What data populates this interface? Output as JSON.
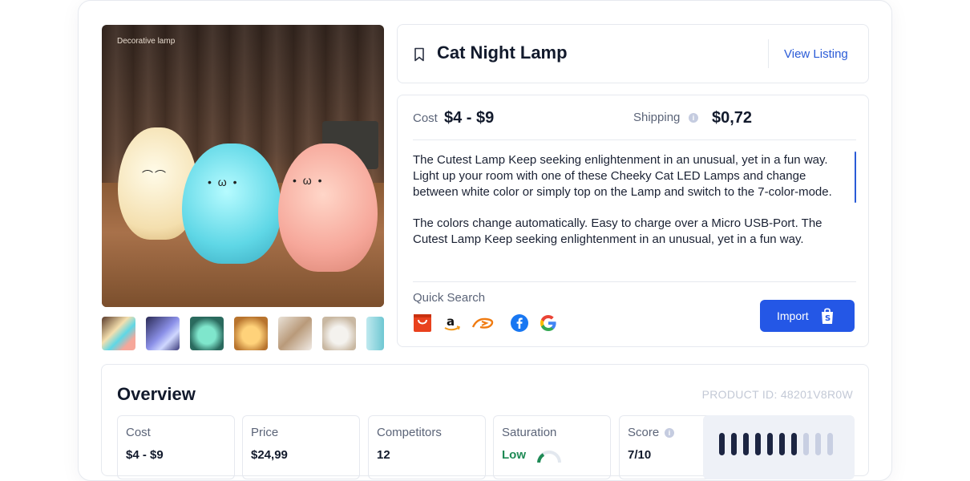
{
  "product": {
    "image_caption": "Decorative lamp",
    "title": "Cat Night Lamp",
    "view_listing": "View Listing"
  },
  "pricing": {
    "cost_label": "Cost",
    "cost_value": "$4 - $9",
    "shipping_label": "Shipping",
    "shipping_info": "i",
    "shipping_value": "$0,72"
  },
  "description": {
    "p1": "The Cutest Lamp Keep seeking enlightenment in an unusual, yet in a fun way. Light up your room with one of these Cheeky Cat LED Lamps and change between white color or simply top on the Lamp and switch to the 7-color-mode.",
    "p2": "The colors change automatically. Easy to charge over a Micro USB-Port. The Cutest Lamp Keep seeking enlightenment in an unusual, yet in a fun way."
  },
  "quick_search": {
    "label": "Quick Search",
    "sources": [
      "aliexpress-icon",
      "amazon-icon",
      "alibaba-icon",
      "facebook-icon",
      "google-icon"
    ],
    "import_label": "Import"
  },
  "overview": {
    "title": "Overview",
    "product_id": "PRODUCT ID: 48201V8R0W",
    "stats": [
      {
        "label": "Cost",
        "value": "$4 - $9"
      },
      {
        "label": "Price",
        "value": "$24,99"
      },
      {
        "label": "Competitors",
        "value": "12"
      },
      {
        "label": "Saturation",
        "value": "Low"
      },
      {
        "label": "Score",
        "value": "7/10"
      }
    ],
    "score_level": 0.7,
    "score_bars_total": 10,
    "score_bars_filled": 7
  },
  "colors": {
    "accent": "#2457e6",
    "link": "#2a5bd7",
    "low_saturation": "#1e8a55",
    "score_filled": "#1c2542",
    "score_empty": "#c8cfe2"
  }
}
